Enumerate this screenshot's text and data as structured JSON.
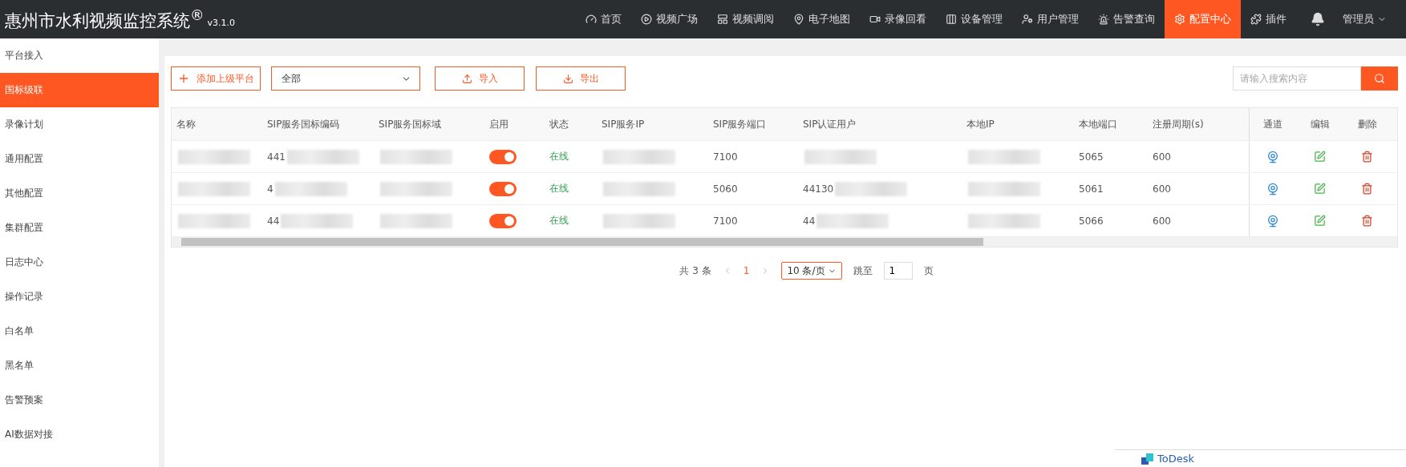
{
  "header": {
    "title": "惠州市水利视频监控系统",
    "title_mark": "®",
    "version": "v3.1.0",
    "nav": [
      {
        "label": "首页",
        "selected": false
      },
      {
        "label": "视频广场",
        "selected": false
      },
      {
        "label": "视频调阅",
        "selected": false
      },
      {
        "label": "电子地图",
        "selected": false
      },
      {
        "label": "录像回看",
        "selected": false
      },
      {
        "label": "设备管理",
        "selected": false
      },
      {
        "label": "用户管理",
        "selected": false
      },
      {
        "label": "告警查询",
        "selected": false
      },
      {
        "label": "配置中心",
        "selected": true
      },
      {
        "label": "插件",
        "selected": false
      }
    ],
    "user": "管理员"
  },
  "sidebar": {
    "items": [
      {
        "label": "平台接入",
        "selected": false
      },
      {
        "label": "国标级联",
        "selected": true
      },
      {
        "label": "录像计划",
        "selected": false
      },
      {
        "label": "通用配置",
        "selected": false
      },
      {
        "label": "其他配置",
        "selected": false
      },
      {
        "label": "集群配置",
        "selected": false
      },
      {
        "label": "日志中心",
        "selected": false
      },
      {
        "label": "操作记录",
        "selected": false
      },
      {
        "label": "白名单",
        "selected": false
      },
      {
        "label": "黑名单",
        "selected": false
      },
      {
        "label": "告警预案",
        "selected": false
      },
      {
        "label": "AI数据对接",
        "selected": false
      }
    ]
  },
  "toolbar": {
    "add_button": "添加上级平台",
    "filter": "全部",
    "import_button": "导入",
    "export_button": "导出",
    "search": {
      "placeholder": "请输入搜索内容"
    }
  },
  "table": {
    "columns": [
      "名称",
      "SIP服务国标编码",
      "SIP服务国标域",
      "启用",
      "状态",
      "SIP服务IP",
      "SIP服务端口",
      "SIP认证用户",
      "本地IP",
      "本地端口",
      "注册周期(s)"
    ],
    "action_columns": [
      "通道",
      "编辑",
      "删除"
    ],
    "rows": [
      {
        "name": "",
        "sip_code": "441",
        "sip_domain": "",
        "enabled": true,
        "status": "在线",
        "sip_ip": "",
        "sip_port": "7100",
        "sip_user": "",
        "local_ip": "",
        "local_port": "5065",
        "period": "600"
      },
      {
        "name": "",
        "sip_code": "4",
        "sip_domain": "",
        "enabled": true,
        "status": "在线",
        "sip_ip": "",
        "sip_port": "5060",
        "sip_user": "44130",
        "local_ip": "",
        "local_port": "5061",
        "period": "600"
      },
      {
        "name": "",
        "sip_code": "44",
        "sip_domain": "",
        "enabled": true,
        "status": "在线",
        "sip_ip": "",
        "sip_port": "7100",
        "sip_user": "44",
        "local_ip": "",
        "local_port": "5066",
        "period": "600"
      }
    ]
  },
  "pagination": {
    "total": "共 3 条",
    "pages": [
      {
        "label": "1",
        "selected": true
      }
    ],
    "page_size": "10 条/页",
    "jump_label": "跳至",
    "jump_value": "1",
    "page_unit": "页"
  },
  "popup": {
    "title": "ToDesk"
  }
}
